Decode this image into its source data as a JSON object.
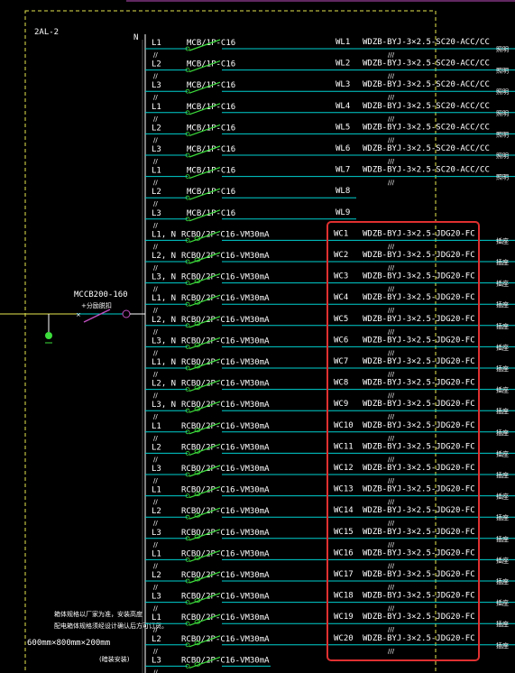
{
  "panel": {
    "name": "2AL-2",
    "neutral_label": "N",
    "main_breaker": "MCCB200-160",
    "main_breaker_sub": "+分励脱扣",
    "enclosure_size": "600mm×800mm×200mm",
    "note_line1": "箱体规格以厂家为准，安装高度",
    "note_line2": "配电箱体规格须经设计确认后方可订货。",
    "note_tail": "(暗装安装)"
  },
  "colors": {
    "line": "#00d0d0",
    "breaker": "#3cdc3c",
    "dashed_frame": "#e8e850",
    "highlight_box": "#e03030",
    "feed_line": "#e8e850"
  },
  "circuits": [
    {
      "phase": "L1",
      "breaker": "MCB/1P-C16",
      "id": "WL1",
      "cable": "WDZB-BYJ-3×2.5-SC20-ACC/CC",
      "use": "照明"
    },
    {
      "phase": "L2",
      "breaker": "MCB/1P-C16",
      "id": "WL2",
      "cable": "WDZB-BYJ-3×2.5-SC20-ACC/CC",
      "use": "照明"
    },
    {
      "phase": "L3",
      "breaker": "MCB/1P-C16",
      "id": "WL3",
      "cable": "WDZB-BYJ-3×2.5-SC20-ACC/CC",
      "use": "照明"
    },
    {
      "phase": "L1",
      "breaker": "MCB/1P-C16",
      "id": "WL4",
      "cable": "WDZB-BYJ-3×2.5-SC20-ACC/CC",
      "use": "照明"
    },
    {
      "phase": "L2",
      "breaker": "MCB/1P-C16",
      "id": "WL5",
      "cable": "WDZB-BYJ-3×2.5-SC20-ACC/CC",
      "use": "照明"
    },
    {
      "phase": "L3",
      "breaker": "MCB/1P-C16",
      "id": "WL6",
      "cable": "WDZB-BYJ-3×2.5-SC20-ACC/CC",
      "use": "照明"
    },
    {
      "phase": "L1",
      "breaker": "MCB/1P-C16",
      "id": "WL7",
      "cable": "WDZB-BYJ-3×2.5-SC20-ACC/CC",
      "use": "照明"
    },
    {
      "phase": "L2",
      "breaker": "MCB/1P-C16",
      "id": "WL8",
      "cable": "",
      "use": ""
    },
    {
      "phase": "L3",
      "breaker": "MCB/1P-C16",
      "id": "WL9",
      "cable": "",
      "use": ""
    },
    {
      "phase": "L1, N",
      "breaker": "RCBO/2P-C16-VM30mA",
      "id": "WC1",
      "cable": "WDZB-BYJ-3×2.5-JDG20-FC",
      "use": "插座"
    },
    {
      "phase": "L2, N",
      "breaker": "RCBO/2P-C16-VM30mA",
      "id": "WC2",
      "cable": "WDZB-BYJ-3×2.5-JDG20-FC",
      "use": "插座"
    },
    {
      "phase": "L3, N",
      "breaker": "RCBO/2P-C16-VM30mA",
      "id": "WC3",
      "cable": "WDZB-BYJ-3×2.5-JDG20-FC",
      "use": "插座"
    },
    {
      "phase": "L1, N",
      "breaker": "RCBO/2P-C16-VM30mA",
      "id": "WC4",
      "cable": "WDZB-BYJ-3×2.5-JDG20-FC",
      "use": "插座"
    },
    {
      "phase": "L2, N",
      "breaker": "RCBO/2P-C16-VM30mA",
      "id": "WC5",
      "cable": "WDZB-BYJ-3×2.5-JDG20-FC",
      "use": "插座"
    },
    {
      "phase": "L3, N",
      "breaker": "RCBO/2P-C16-VM30mA",
      "id": "WC6",
      "cable": "WDZB-BYJ-3×2.5-JDG20-FC",
      "use": "插座"
    },
    {
      "phase": "L1, N",
      "breaker": "RCBO/2P-C16-VM30mA",
      "id": "WC7",
      "cable": "WDZB-BYJ-3×2.5-JDG20-FC",
      "use": "插座"
    },
    {
      "phase": "L2, N",
      "breaker": "RCBO/2P-C16-VM30mA",
      "id": "WC8",
      "cable": "WDZB-BYJ-3×2.5-JDG20-FC",
      "use": "插座"
    },
    {
      "phase": "L3, N",
      "breaker": "RCBO/2P-C16-VM30mA",
      "id": "WC9",
      "cable": "WDZB-BYJ-3×2.5-JDG20-FC",
      "use": "插座"
    },
    {
      "phase": "L1",
      "breaker": "RCBO/2P-C16-VM30mA",
      "id": "WC10",
      "cable": "WDZB-BYJ-3×2.5-JDG20-FC",
      "use": "插座"
    },
    {
      "phase": "L2",
      "breaker": "RCBO/2P-C16-VM30mA",
      "id": "WC11",
      "cable": "WDZB-BYJ-3×2.5-JDG20-FC",
      "use": "插座"
    },
    {
      "phase": "L3",
      "breaker": "RCBO/2P-C16-VM30mA",
      "id": "WC12",
      "cable": "WDZB-BYJ-3×2.5-JDG20-FC",
      "use": "插座"
    },
    {
      "phase": "L1",
      "breaker": "RCBO/2P-C16-VM30mA",
      "id": "WC13",
      "cable": "WDZB-BYJ-3×2.5-JDG20-FC",
      "use": "插座"
    },
    {
      "phase": "L2",
      "breaker": "RCBO/2P-C16-VM30mA",
      "id": "WC14",
      "cable": "WDZB-BYJ-3×2.5-JDG20-FC",
      "use": "插座"
    },
    {
      "phase": "L3",
      "breaker": "RCBO/2P-C16-VM30mA",
      "id": "WC15",
      "cable": "WDZB-BYJ-3×2.5-JDG20-FC",
      "use": "插座"
    },
    {
      "phase": "L1",
      "breaker": "RCBO/2P-C16-VM30mA",
      "id": "WC16",
      "cable": "WDZB-BYJ-3×2.5-JDG20-FC",
      "use": "插座"
    },
    {
      "phase": "L2",
      "breaker": "RCBO/2P-C16-VM30mA",
      "id": "WC17",
      "cable": "WDZB-BYJ-3×2.5-JDG20-FC",
      "use": "插座"
    },
    {
      "phase": "L3",
      "breaker": "RCBO/2P-C16-VM30mA",
      "id": "WC18",
      "cable": "WDZB-BYJ-3×2.5-JDG20-FC",
      "use": "插座"
    },
    {
      "phase": "L1",
      "breaker": "RCBO/2P-C16-VM30mA",
      "id": "WC19",
      "cable": "WDZB-BYJ-3×2.5-JDG20-FC",
      "use": "插座"
    },
    {
      "phase": "L2",
      "breaker": "RCBO/2P-C16-VM30mA",
      "id": "WC20",
      "cable": "WDZB-BYJ-3×2.5-JDG20-FC",
      "use": "插座"
    },
    {
      "phase": "L3",
      "breaker": "RCBO/2P-C16-VM30mA",
      "id": "",
      "cable": "",
      "use": ""
    }
  ]
}
